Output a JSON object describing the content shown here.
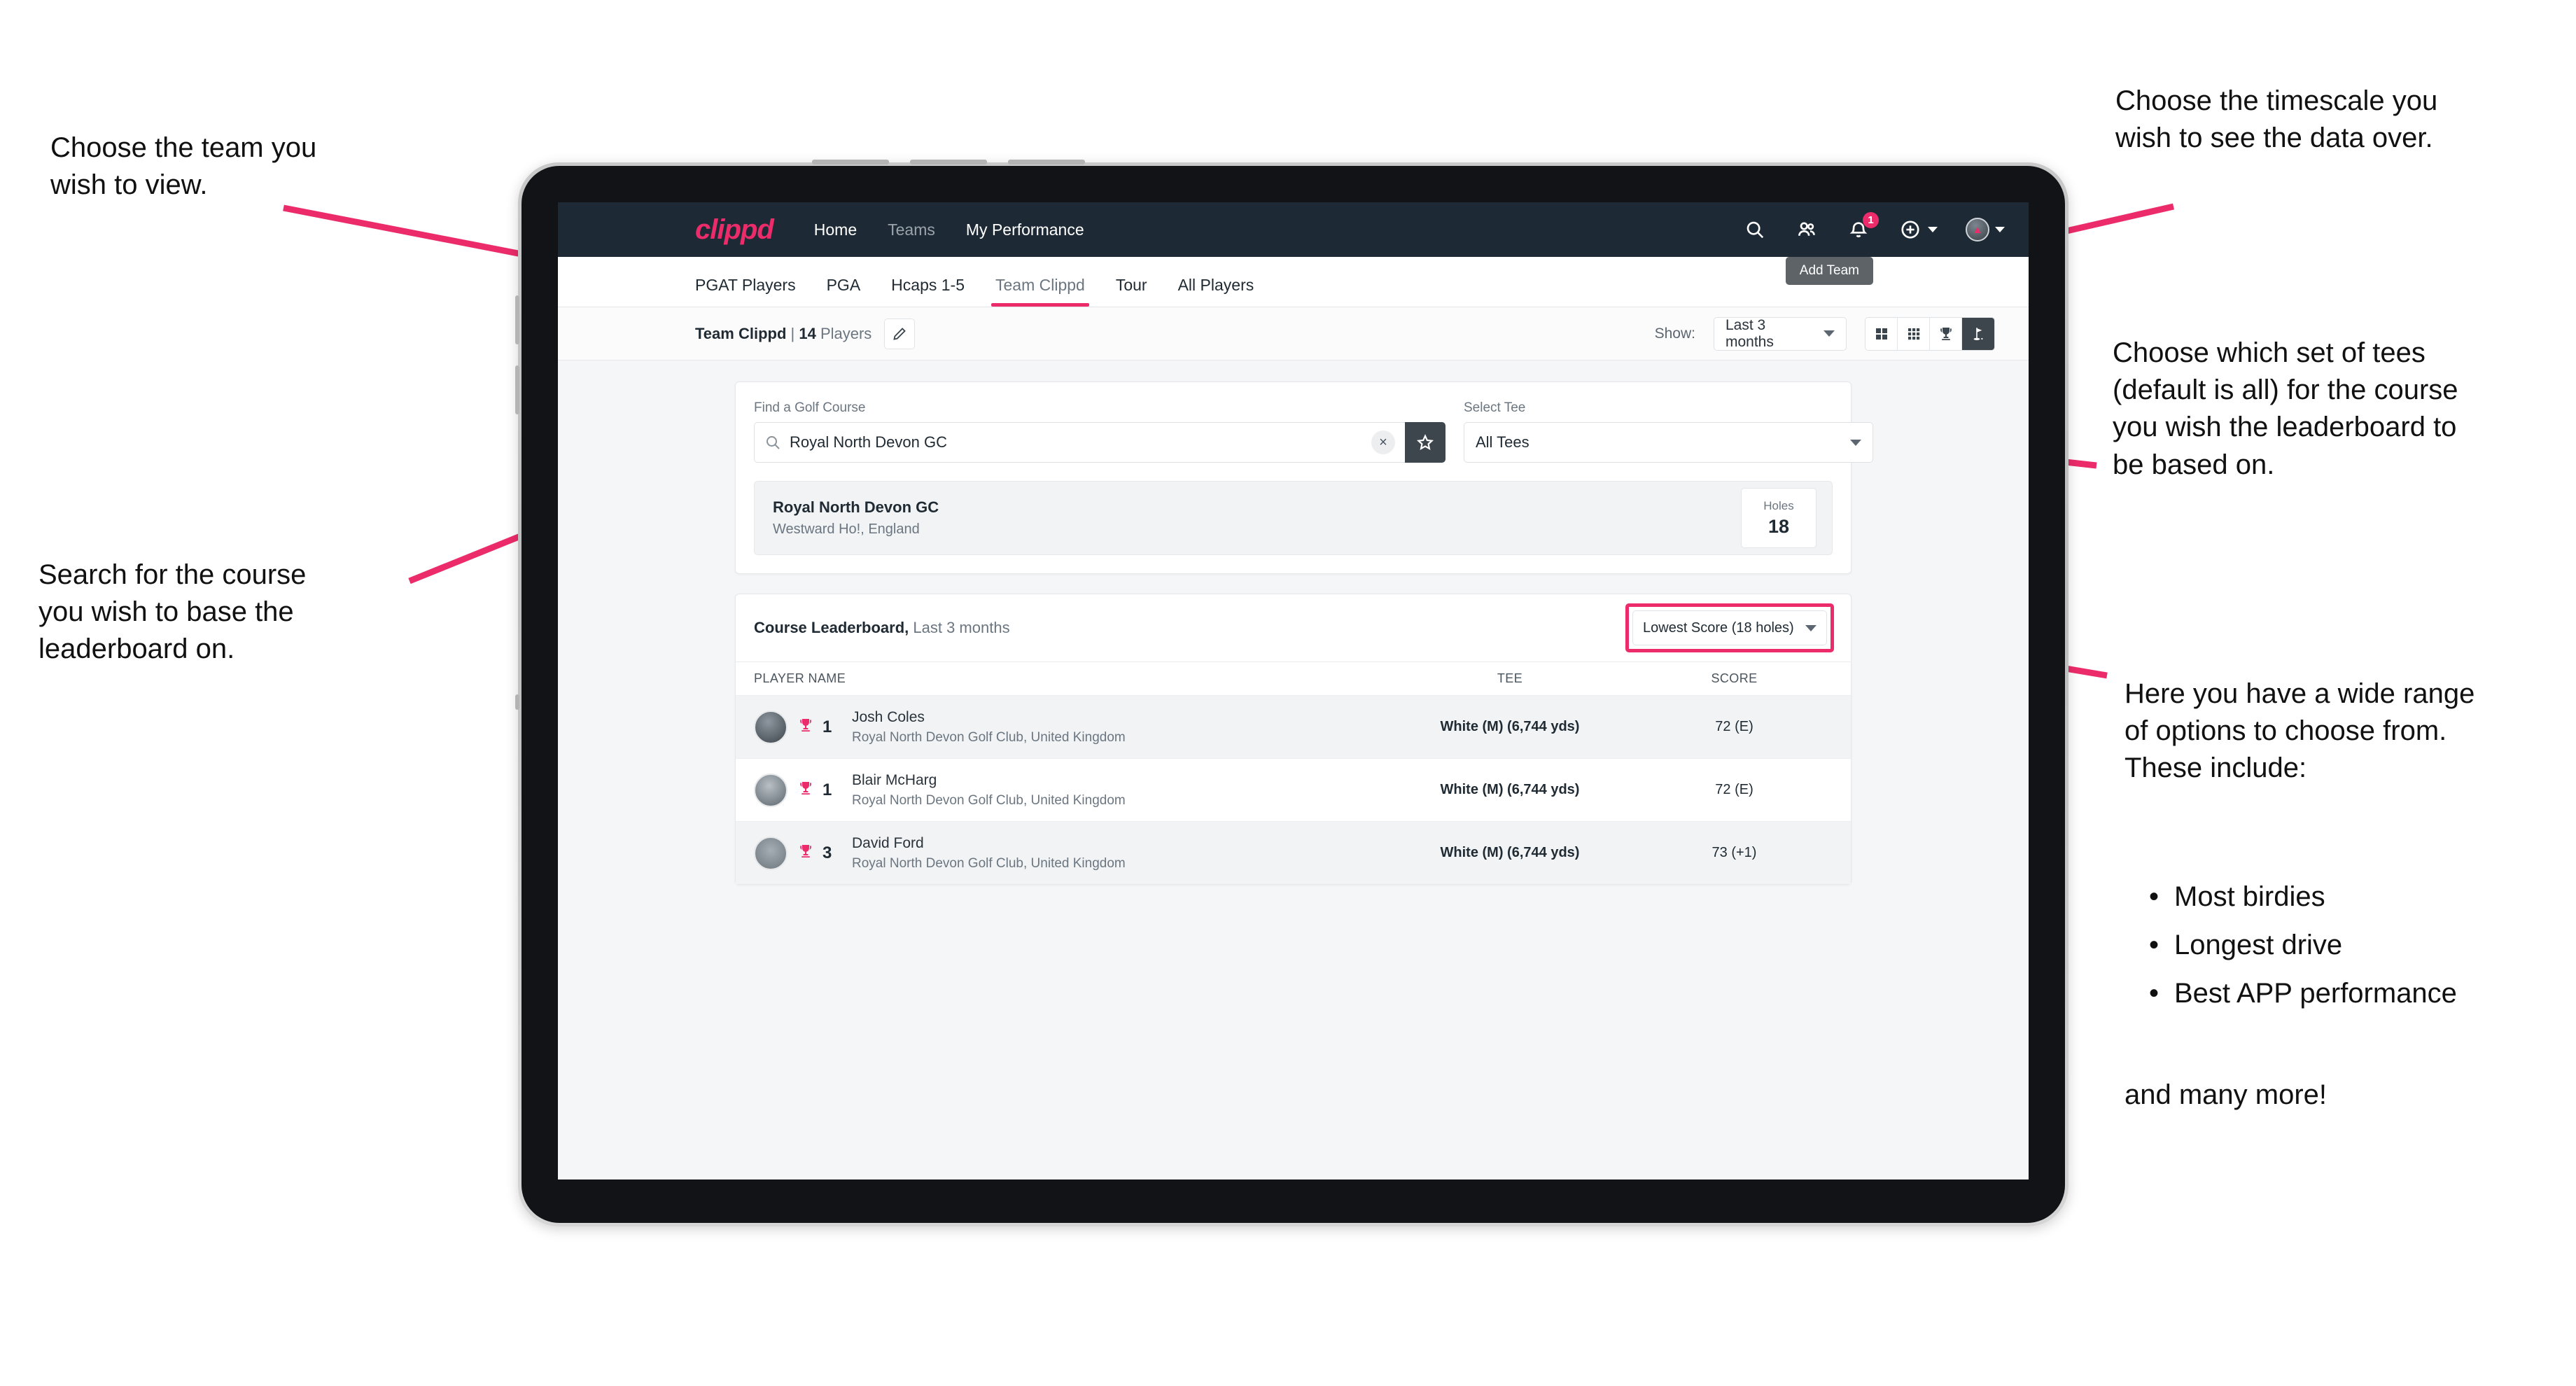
{
  "annotations": {
    "left_top": "Choose the team you\nwish to view.",
    "left_mid": "Search for the course\nyou wish to base the\nleaderboard on.",
    "right_top": "Choose the timescale you\nwish to see the data over.",
    "right_mid": "Choose which set of tees\n(default is all) for the course\nyou wish the leaderboard to\nbe based on.",
    "right_bottom_intro": "Here you have a wide range\nof options to choose from.\nThese include:",
    "right_bottom_bullets": [
      "Most birdies",
      "Longest drive",
      "Best APP performance"
    ],
    "right_bottom_outro": "and many more!"
  },
  "navbar": {
    "brand": "clippd",
    "links": [
      {
        "label": "Home",
        "dim": false
      },
      {
        "label": "Teams",
        "dim": true
      },
      {
        "label": "My Performance",
        "dim": false
      }
    ],
    "icons": {
      "search": "search-icon",
      "people": "people-icon",
      "bell": "bell-icon",
      "bell_badge": "1",
      "plus": "plus-circle-icon",
      "avatar": "avatar-icon"
    }
  },
  "tooltip": {
    "text": "Add Team"
  },
  "tabs": [
    {
      "label": "PGAT Players",
      "active": false
    },
    {
      "label": "PGA",
      "active": false
    },
    {
      "label": "Hcaps 1-5",
      "active": false
    },
    {
      "label": "Team Clippd",
      "active": true
    },
    {
      "label": "Tour",
      "active": false
    },
    {
      "label": "All Players",
      "active": false
    }
  ],
  "toolbar": {
    "team_name": "Team Clippd",
    "separator": " | ",
    "player_count": "14",
    "players_word": "Players",
    "edit_icon": "pencil-icon",
    "show_label": "Show:",
    "timescale_value": "Last 3 months",
    "views": [
      {
        "name": "grid-2x2-view",
        "active": false
      },
      {
        "name": "grid-3x3-view",
        "active": false
      },
      {
        "name": "trophy-view",
        "active": false
      },
      {
        "name": "golf-flag-view",
        "active": true
      }
    ]
  },
  "search": {
    "course_label": "Find a Golf Course",
    "course_value": "Royal North Devon GC",
    "course_placeholder": "Find a Golf Course",
    "clear_icon": "close-icon",
    "star_icon": "star-icon",
    "tee_label": "Select Tee",
    "tee_value": "All Tees"
  },
  "course_result": {
    "name": "Royal North Devon GC",
    "location": "Westward Ho!, England",
    "holes_label": "Holes",
    "holes_value": "18"
  },
  "leaderboard": {
    "title": "Course Leaderboard,",
    "subtitle": " Last 3 months",
    "sort_value": "Lowest Score (18 holes)",
    "columns": [
      "PLAYER NAME",
      "TEE",
      "SCORE"
    ],
    "rows": [
      {
        "rank": "1",
        "name": "Josh Coles",
        "club": "Royal North Devon Golf Club, United Kingdom",
        "tee": "White (M) (6,744 yds)",
        "score": "72 (E)"
      },
      {
        "rank": "1",
        "name": "Blair McHarg",
        "club": "Royal North Devon Golf Club, United Kingdom",
        "tee": "White (M) (6,744 yds)",
        "score": "72 (E)"
      },
      {
        "rank": "3",
        "name": "David Ford",
        "club": "Royal North Devon Golf Club, United Kingdom",
        "tee": "White (M) (6,744 yds)",
        "score": "73 (+1)"
      }
    ]
  },
  "colors": {
    "accent": "#ec2c6a",
    "navbar": "#1d2a35",
    "dark_button": "#3e464d",
    "page_bg": "#f5f6f8"
  }
}
